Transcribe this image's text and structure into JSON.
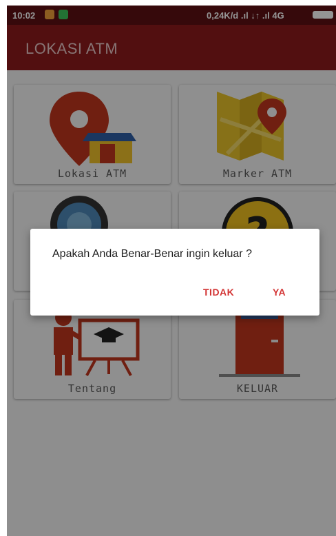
{
  "status_bar": {
    "time": "10:02",
    "network": "0,24K/d  .ıl  ↓↑ .ıl 4G",
    "icons": [
      "notification-icon",
      "app-icon",
      "signal-icon",
      "battery-icon"
    ]
  },
  "toolbar": {
    "title": "LOKASI ATM"
  },
  "menu": {
    "items": [
      {
        "label": "Lokasi ATM",
        "icon": "location-pin-house-icon"
      },
      {
        "label": "Marker ATM",
        "icon": "map-marker-icon"
      },
      {
        "label": "",
        "icon": "camera-lens-icon"
      },
      {
        "label": "",
        "icon": "question-icon"
      },
      {
        "label": "Tentang",
        "icon": "teacher-board-icon"
      },
      {
        "label": "KELUAR",
        "icon": "exit-door-icon"
      }
    ]
  },
  "dialog": {
    "message": "Apakah Anda Benar-Benar ingin keluar ?",
    "negative_label": "TIDAK",
    "positive_label": "YA"
  },
  "colors": {
    "status_bar": "#5e1113",
    "toolbar": "#8e1a1d",
    "dialog_button": "#d33434"
  }
}
